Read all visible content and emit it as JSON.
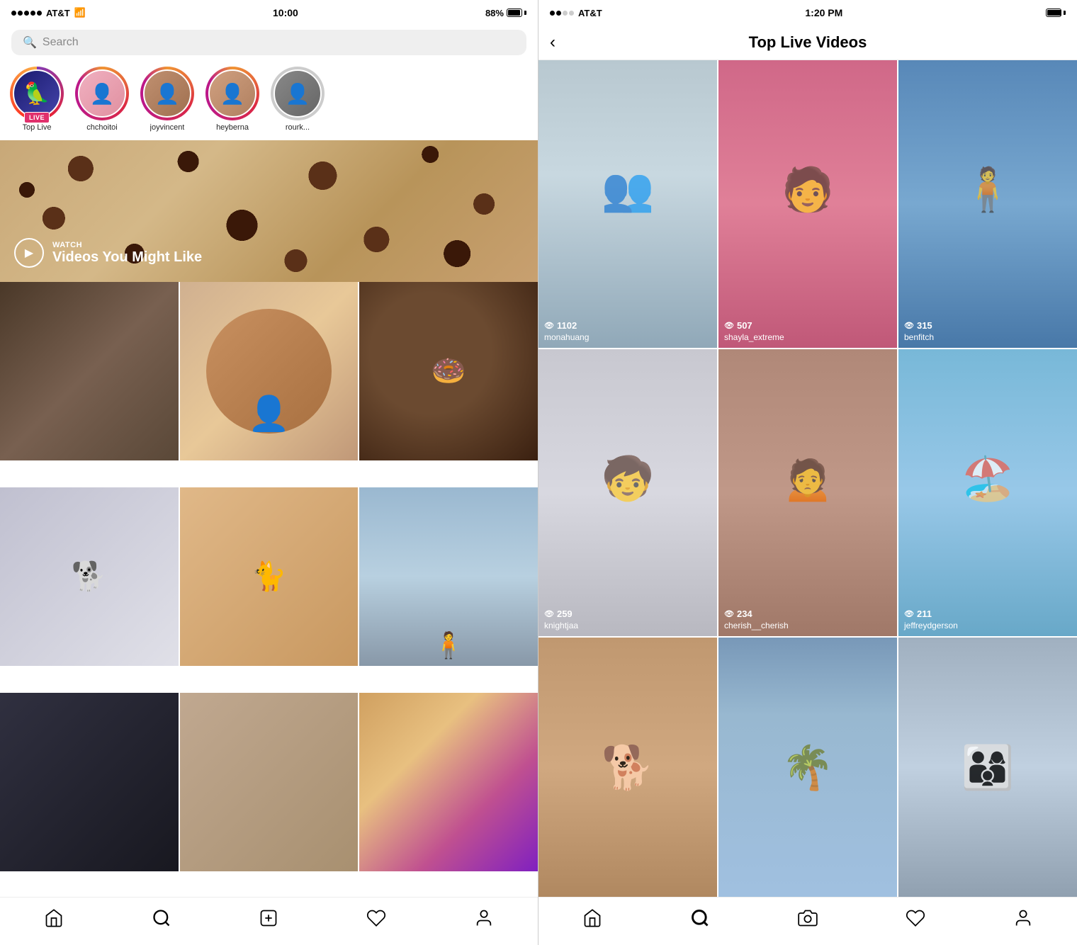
{
  "left": {
    "status": {
      "carrier": "AT&T",
      "time": "10:00",
      "battery_pct": "88%"
    },
    "search_placeholder": "Search",
    "stories": [
      {
        "id": "top-live",
        "name": "Top Live",
        "is_live": true,
        "avatar_class": "av-blue"
      },
      {
        "id": "chchoitoi",
        "name": "chchoitoi",
        "is_live": false,
        "avatar_class": "av-pink"
      },
      {
        "id": "joyvincent",
        "name": "joyvincent",
        "is_live": false,
        "avatar_class": "av-tan"
      },
      {
        "id": "heyberna",
        "name": "heyberna",
        "is_live": false,
        "avatar_class": "av-green"
      },
      {
        "id": "rourk",
        "name": "rourk...",
        "is_live": false,
        "avatar_class": "av-gray"
      }
    ],
    "featured": {
      "watch_label": "WATCH",
      "title": "Videos You Might Like"
    },
    "bottom_nav": [
      "home",
      "search",
      "add",
      "heart",
      "person"
    ]
  },
  "right": {
    "status": {
      "carrier": "AT&T",
      "time": "1:20 PM"
    },
    "header": {
      "back_label": "‹",
      "title": "Top Live Videos"
    },
    "live_videos": [
      {
        "id": "monahuang",
        "username": "monahuang",
        "viewers": "1102",
        "bg": "lc1"
      },
      {
        "id": "shayla_extreme",
        "username": "shayla_extreme",
        "viewers": "507",
        "bg": "lc2"
      },
      {
        "id": "benfitch",
        "username": "benfitch",
        "viewers": "315",
        "bg": "lc3"
      },
      {
        "id": "knightjaa",
        "username": "knightjaa",
        "viewers": "259",
        "bg": "lc4"
      },
      {
        "id": "cherish__cherish",
        "username": "cherish__cherish",
        "viewers": "234",
        "bg": "lc5"
      },
      {
        "id": "jeffreydgerson",
        "username": "jeffreydgerson",
        "viewers": "211",
        "bg": "lc6"
      },
      {
        "id": "dog_video",
        "username": "",
        "viewers": "",
        "bg": "lc7"
      },
      {
        "id": "palm_trees",
        "username": "",
        "viewers": "",
        "bg": "lc8"
      },
      {
        "id": "group_video",
        "username": "",
        "viewers": "",
        "bg": "lc9"
      }
    ],
    "bottom_nav": [
      "home",
      "search",
      "camera",
      "heart",
      "person"
    ]
  }
}
